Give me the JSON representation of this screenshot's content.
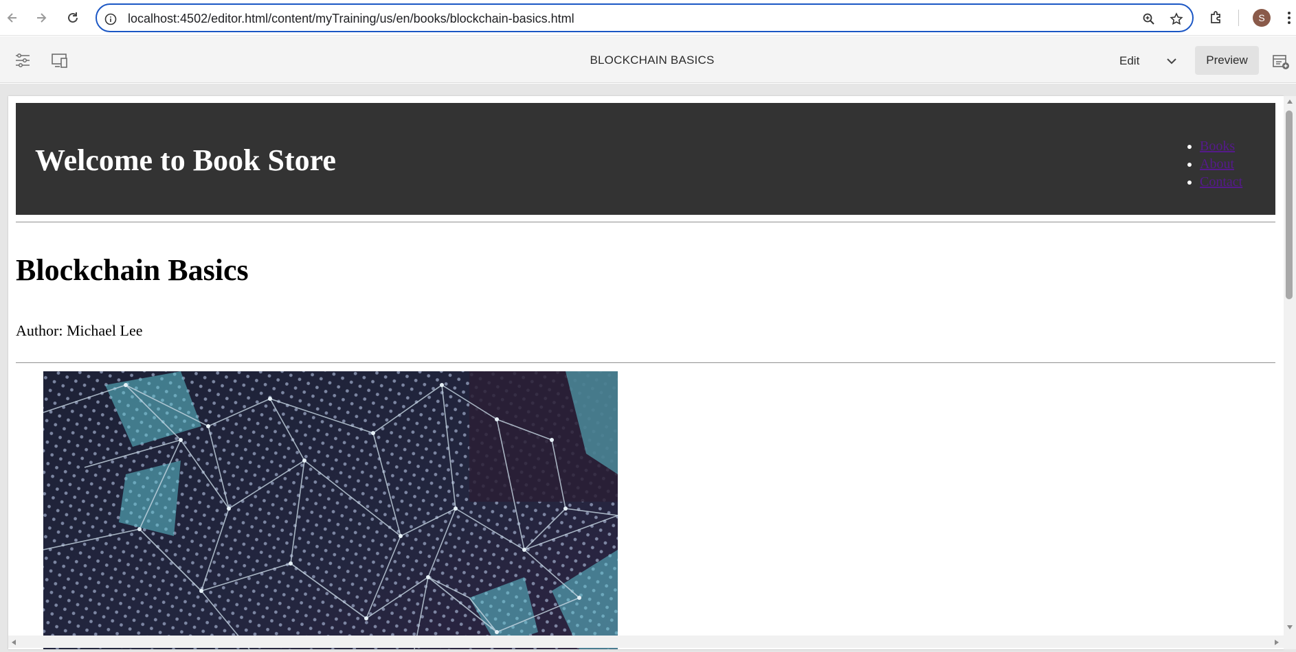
{
  "browser": {
    "url": "localhost:4502/editor.html/content/myTraining/us/en/books/blockchain-basics.html",
    "avatar_letter": "S",
    "icons": [
      "back-arrow-icon",
      "forward-arrow-icon",
      "reload-icon",
      "site-info-icon",
      "zoom-icon",
      "bookmark-star-icon",
      "extensions-icon",
      "more-vert-icon"
    ]
  },
  "editor": {
    "title": "BLOCKCHAIN BASICS",
    "mode_label": "Edit",
    "preview_label": "Preview",
    "icons": [
      "page-properties-icon",
      "emulator-icon",
      "chevron-down-icon",
      "side-panel-icon"
    ]
  },
  "page": {
    "site_title": "Welcome to Book Store",
    "nav": [
      "Books",
      "About",
      "Contact"
    ],
    "book_title": "Blockchain Basics",
    "author": "Author: Michael Lee"
  },
  "colors": {
    "header_bg": "#333333",
    "omnibox_border": "#1a56c4",
    "link_visited": "#551a8b",
    "editor_bar": "#f4f4f4"
  }
}
